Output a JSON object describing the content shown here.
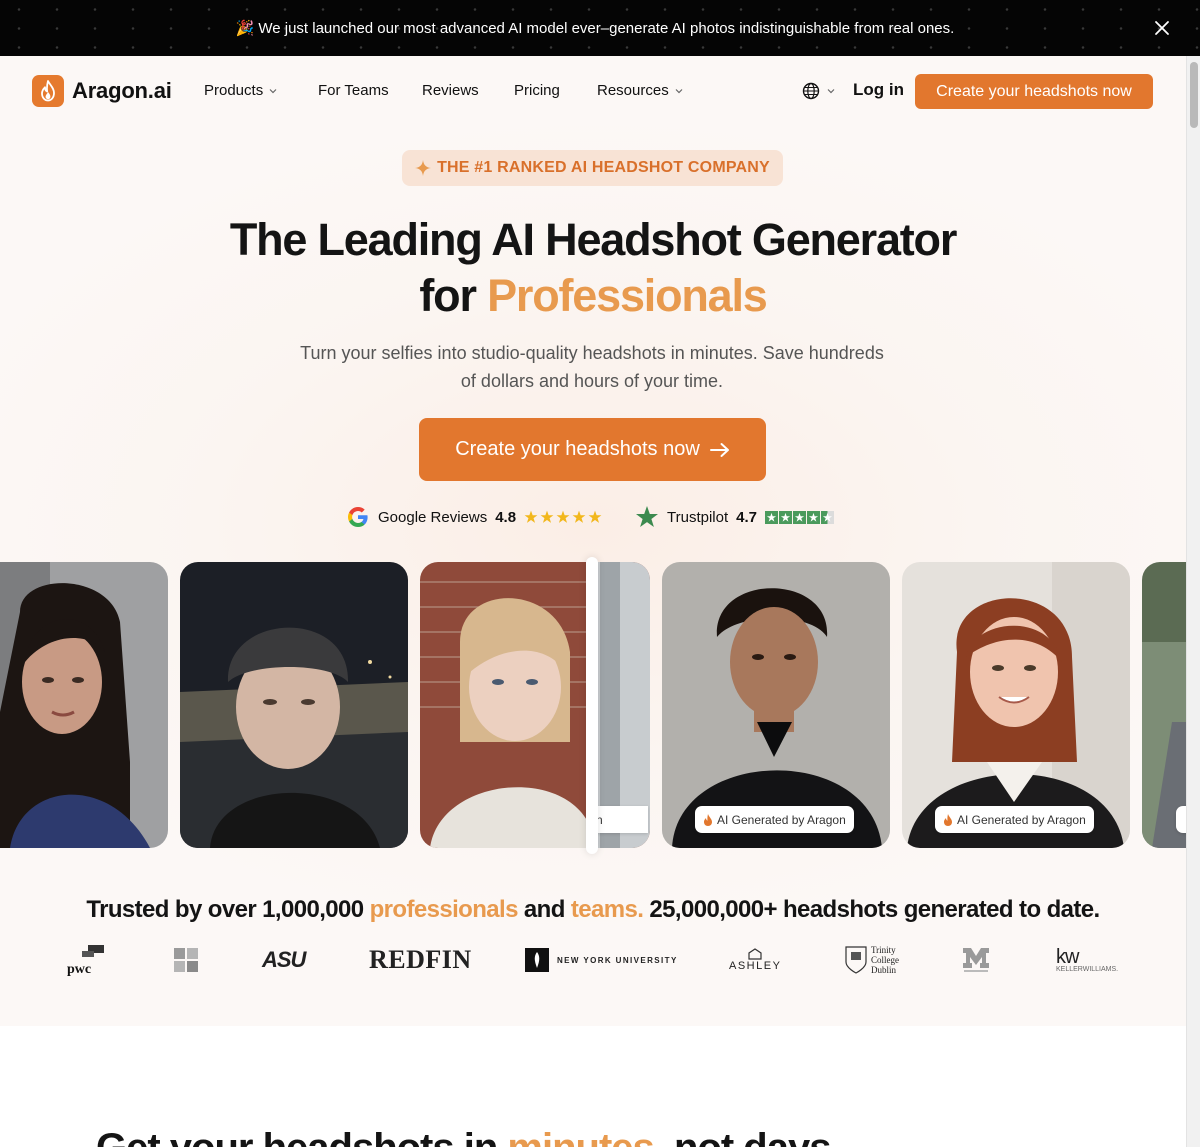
{
  "announcement": {
    "emoji": "🎉",
    "text": "We just launched our most advanced AI model ever–generate AI photos indistinguishable from real ones."
  },
  "nav": {
    "logo_text": "Aragon.ai",
    "items": [
      {
        "label": "Products",
        "has_dropdown": true
      },
      {
        "label": "For Teams",
        "has_dropdown": false
      },
      {
        "label": "Reviews",
        "has_dropdown": false
      },
      {
        "label": "Pricing",
        "has_dropdown": false
      },
      {
        "label": "Resources",
        "has_dropdown": true
      }
    ],
    "login_label": "Log in",
    "cta_label": "Create your headshots now"
  },
  "hero": {
    "badge": "THE #1 RANKED AI HEADSHOT COMPANY",
    "title_line1": "The Leading AI Headshot Generator",
    "title_line2_prefix": "for ",
    "title_line2_accent": "Professionals",
    "subtitle": "Turn your selfies into studio-quality headshots in minutes. Save hundreds of dollars and hours of your time.",
    "cta_label": "Create your headshots now"
  },
  "reviews": {
    "google": {
      "label": "Google Reviews",
      "score": "4.8",
      "stars": 5
    },
    "trustpilot": {
      "label": "Trustpilot",
      "score": "4.7",
      "stars": 4.5
    }
  },
  "photos": {
    "ai_tag": "AI Generated by Aragon",
    "partial_tag": "n"
  },
  "trusted": {
    "prefix": "Trusted by over 1,000,000 ",
    "accent1": "professionals",
    "middle": " and ",
    "accent2": "teams.",
    "suffix": " 25,000,000+ headshots generated to date."
  },
  "company_logos": {
    "pwc": "pwc",
    "asu": "ASU",
    "redfin": "REDFIN",
    "nyu": "NEW YORK UNIVERSITY",
    "ashley": "ASHLEY",
    "trinity_1": "Trinity",
    "trinity_2": "College",
    "trinity_3": "Dublin",
    "kw": "kw",
    "kw_sub": "KELLERWILLIAMS."
  },
  "lower": {
    "prefix": "Get your headshots in ",
    "accent": "minutes",
    "suffix": ", not days"
  },
  "colors": {
    "accent": "#e2772e",
    "accent_light": "#e89a4e",
    "badge_bg": "#f8e3d5"
  }
}
